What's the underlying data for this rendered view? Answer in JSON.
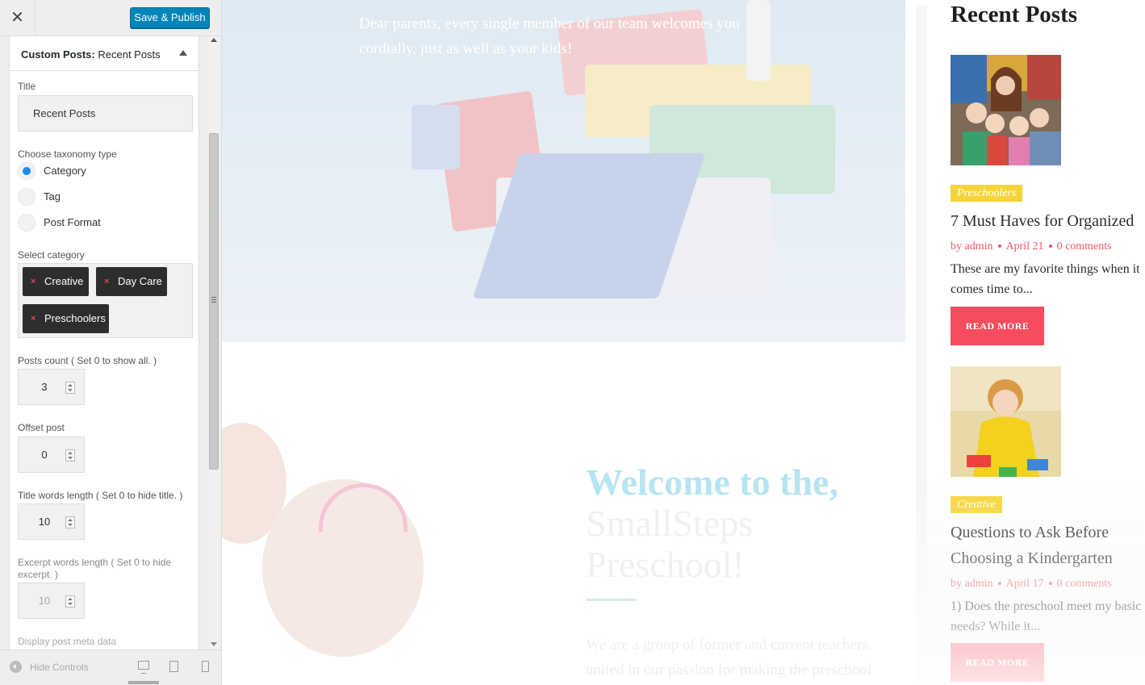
{
  "topbar": {
    "close_glyph": "✕",
    "publish_label": "Save & Publish"
  },
  "section": {
    "prefix": "Custom Posts:",
    "name": "Recent Posts"
  },
  "controls": {
    "title_label": "Title",
    "title_value": "Recent Posts",
    "taxonomy_label": "Choose taxonomy type",
    "taxonomy_options": [
      {
        "label": "Category",
        "checked": true
      },
      {
        "label": "Tag",
        "checked": false
      },
      {
        "label": "Post Format",
        "checked": false
      }
    ],
    "category_label": "Select category",
    "categories": [
      "Creative",
      "Day Care",
      "Preschoolers"
    ],
    "chip_remove_glyph": "×",
    "posts_count_label": "Posts count ( Set 0 to show all. )",
    "posts_count": "3",
    "offset_label": "Offset post",
    "offset": "0",
    "title_words_label": "Title words length ( Set 0 to hide title. )",
    "title_words": "10",
    "excerpt_words_label": "Excerpt words length ( Set 0 to hide excerpt. )",
    "excerpt_words": "10",
    "meta_label": "Display post meta data"
  },
  "footer": {
    "hide_label": "Hide Controls",
    "icons": [
      "hide-controls-icon",
      "desktop-preview-icon",
      "tablet-preview-icon",
      "mobile-preview-icon"
    ]
  },
  "preview": {
    "hero_text": "Dear parents, every single member of our team welcomes you cordially, just as well as your kids!",
    "welcome_line1": "Welcome to the,",
    "welcome_line2": "SmallSteps",
    "welcome_line3": "Preschool!",
    "about_text": "We are a group of former and current teachers, united in our passion for making the preschool"
  },
  "widget": {
    "title": "Recent Posts",
    "posts": [
      {
        "category": "Preschoolers",
        "title": "7 Must Haves for Organized",
        "author": "by admin",
        "date": "April 21",
        "comments": "0 comments",
        "excerpt": "These are my favorite things when it comes time to...",
        "button": "READ MORE"
      },
      {
        "category": "Creative",
        "title_line1": "Questions to Ask Before",
        "title_line2": "Choosing a Kindergarten",
        "author": "by admin",
        "date": "April 17",
        "comments": "0 comments",
        "excerpt": "1) Does the preschool meet my basic needs? While it...",
        "button": "READ MORE"
      }
    ]
  },
  "colors": {
    "publish_blue": "#0085ba",
    "radio_blue": "#1e8cea",
    "chip_dark": "#2b2d2f",
    "accent_red": "#f54c5e",
    "badge_yellow": "#f5d43a",
    "welcome_blue": "#b6e5f1"
  }
}
